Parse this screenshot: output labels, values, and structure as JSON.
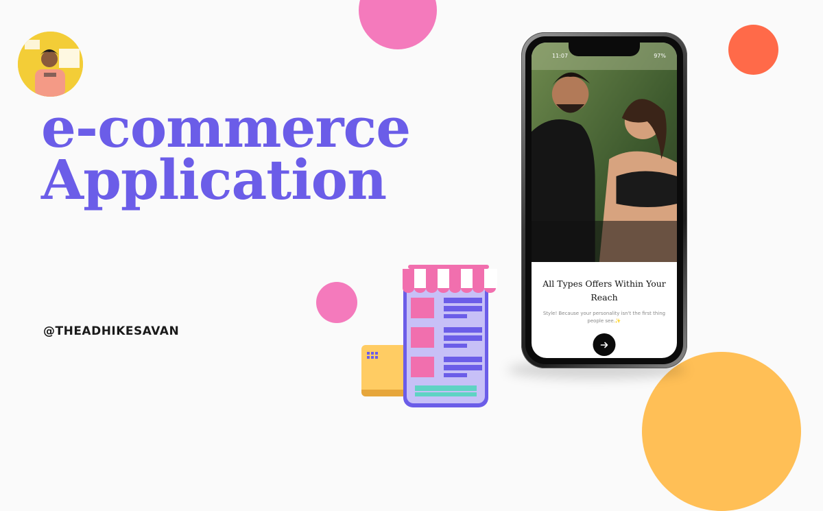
{
  "profile": {
    "handle": "@THEADHIKESAVAN"
  },
  "headline": {
    "line1": "e-commerce",
    "line2": "Application"
  },
  "phone": {
    "status_time": "11:07",
    "status_battery": "97%",
    "title": "All Types Offers Within Your Reach",
    "subtitle": "Style! Because your personality isn't the first thing people see.✨",
    "next_icon": "arrow-right-icon"
  },
  "colors": {
    "headline": "#6b5de8",
    "pink": "#f47abc",
    "orange": "#ff6a49",
    "yellow": "#ffbf56",
    "store_purple": "#7b6ce8"
  }
}
